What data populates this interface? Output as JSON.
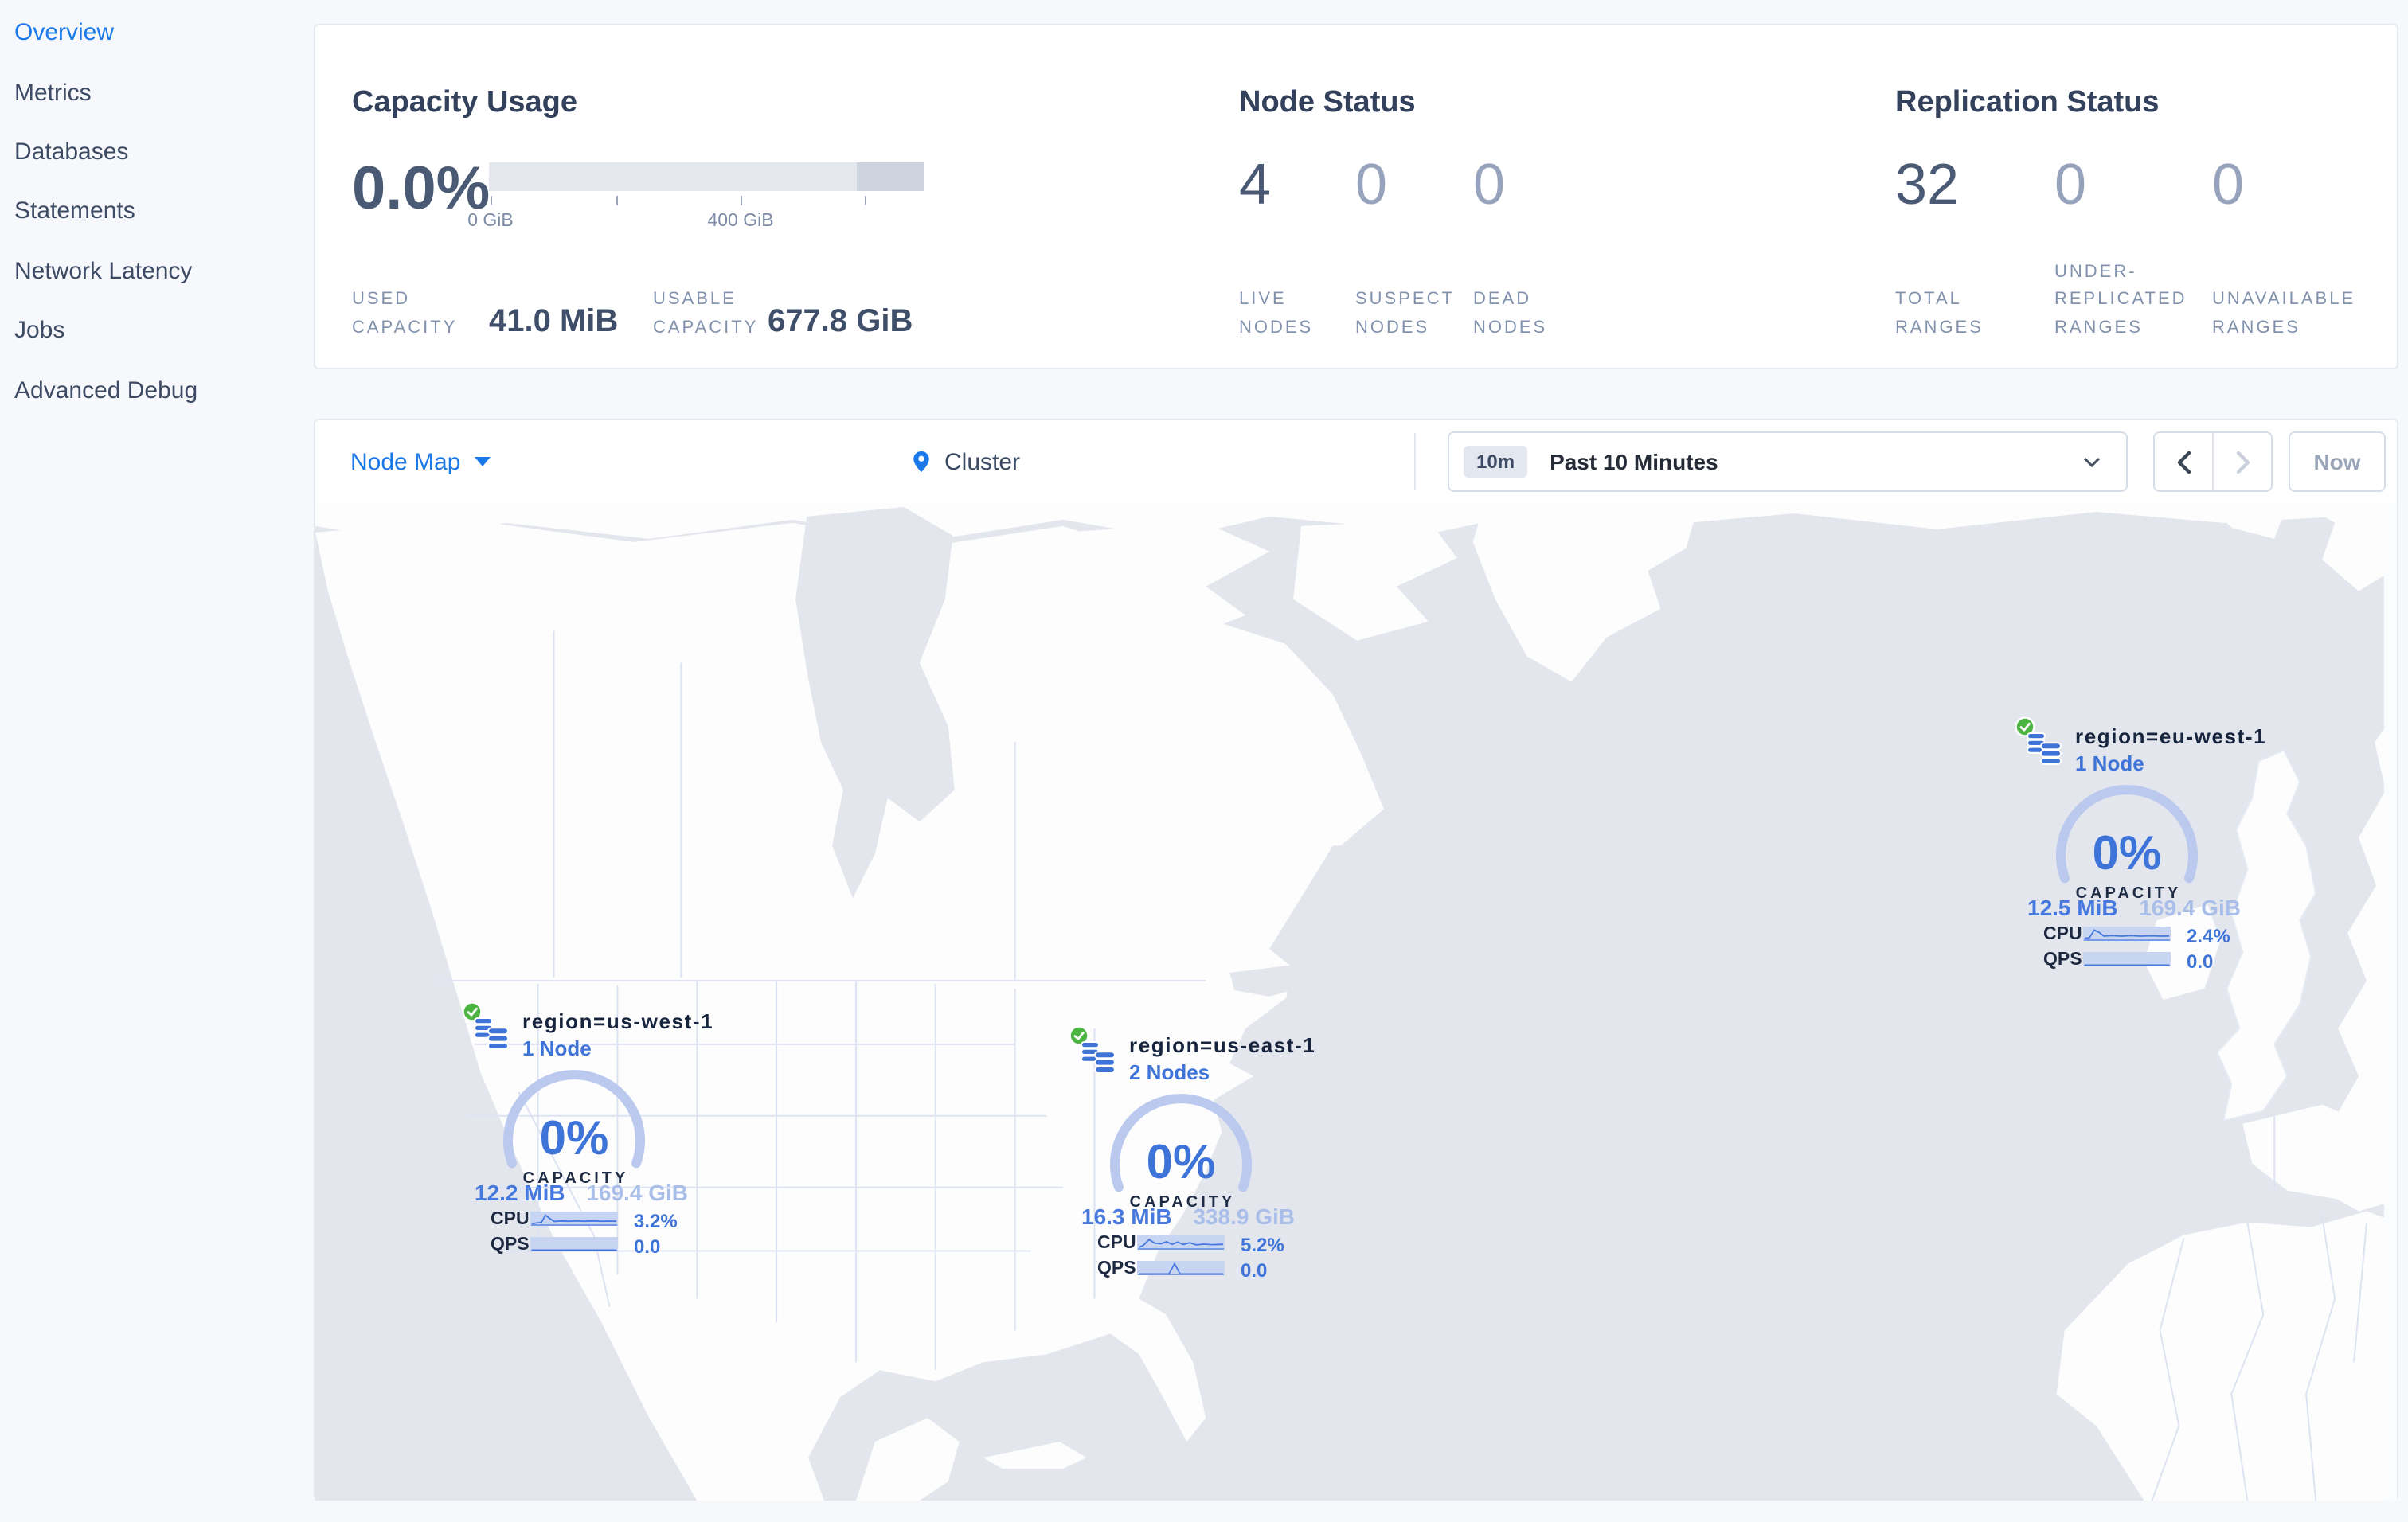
{
  "sidebar": {
    "items": [
      {
        "label": "Overview",
        "active": true
      },
      {
        "label": "Metrics",
        "active": false
      },
      {
        "label": "Databases",
        "active": false
      },
      {
        "label": "Statements",
        "active": false
      },
      {
        "label": "Network Latency",
        "active": false
      },
      {
        "label": "Jobs",
        "active": false
      },
      {
        "label": "Advanced Debug",
        "active": false
      }
    ]
  },
  "cards": {
    "capacity": {
      "title": "Capacity Usage",
      "percent": "0.0%",
      "ticks": [
        "0 GiB",
        "400 GiB"
      ],
      "used": {
        "label": "USED CAPACITY",
        "value": "41.0 MiB"
      },
      "usable": {
        "label": "USABLE CAPACITY",
        "value": "677.8 GiB"
      }
    },
    "node_status": {
      "title": "Node Status",
      "stats": [
        {
          "value": "4",
          "label": "LIVE NODES"
        },
        {
          "value": "0",
          "label": "SUSPECT NODES"
        },
        {
          "value": "0",
          "label": "DEAD NODES"
        }
      ]
    },
    "replication": {
      "title": "Replication Status",
      "stats": [
        {
          "value": "32",
          "label": "TOTAL RANGES"
        },
        {
          "value": "0",
          "label": "UNDER-REPLICATED RANGES"
        },
        {
          "value": "0",
          "label": "UNAVAILABLE RANGES"
        }
      ]
    }
  },
  "toolbar": {
    "view_selector": "Node Map",
    "scope_label": "Cluster",
    "time_badge": "10m",
    "time_range": "Past 10 Minutes",
    "now_button": "Now"
  },
  "map": {
    "regions": [
      {
        "name": "region=us-west-1",
        "nodes": "1 Node",
        "capacity_percent": "0%",
        "capacity_label": "CAPACITY",
        "used": "12.2 MiB",
        "total": "169.4 GiB",
        "cpu_label": "CPU",
        "cpu_value": "3.2%",
        "qps_label": "QPS",
        "qps_value": "0.0",
        "cpu_spark": [
          [
            1,
            7.6
          ],
          [
            4,
            7.2
          ],
          [
            7,
            6.8
          ],
          [
            9.5,
            2.3
          ],
          [
            12,
            4.2
          ],
          [
            15,
            6.2
          ],
          [
            19,
            5.9
          ],
          [
            24,
            6.1
          ],
          [
            29,
            5.9
          ],
          [
            34,
            6.1
          ],
          [
            39,
            5.9
          ],
          [
            45,
            6.1
          ],
          [
            50,
            6.0
          ],
          [
            54,
            6.1
          ]
        ],
        "qps_spark": [
          [
            1,
            8.2
          ],
          [
            54,
            8.2
          ]
        ]
      },
      {
        "name": "region=us-east-1",
        "nodes": "2 Nodes",
        "capacity_percent": "0%",
        "capacity_label": "CAPACITY",
        "used": "16.3 MiB",
        "total": "338.9 GiB",
        "cpu_label": "CPU",
        "cpu_value": "5.2%",
        "qps_label": "QPS",
        "qps_value": "0.0",
        "cpu_spark": [
          [
            1,
            7.6
          ],
          [
            4,
            6.2
          ],
          [
            7.5,
            2.6
          ],
          [
            11,
            4.8
          ],
          [
            15,
            5.2
          ],
          [
            18.5,
            4.0
          ],
          [
            22,
            5.6
          ],
          [
            25.5,
            4.2
          ],
          [
            29,
            5.7
          ],
          [
            33,
            4.6
          ],
          [
            37,
            5.9
          ],
          [
            42,
            5.5
          ],
          [
            47,
            5.8
          ],
          [
            54,
            5.6
          ]
        ],
        "qps_spark": [
          [
            1,
            8.2
          ],
          [
            20,
            8.2
          ],
          [
            23.5,
            1.8
          ],
          [
            27,
            8.2
          ],
          [
            54,
            8.2
          ]
        ]
      },
      {
        "name": "region=eu-west-1",
        "nodes": "1 Node",
        "capacity_percent": "0%",
        "capacity_label": "CAPACITY",
        "used": "12.5 MiB",
        "total": "169.4 GiB",
        "cpu_label": "CPU",
        "cpu_value": "2.4%",
        "qps_label": "QPS",
        "qps_value": "0.0",
        "cpu_spark": [
          [
            1,
            7.4
          ],
          [
            4,
            7.0
          ],
          [
            7,
            2.2
          ],
          [
            10,
            3.6
          ],
          [
            13,
            6.0
          ],
          [
            18,
            5.7
          ],
          [
            24,
            6.0
          ],
          [
            30,
            5.7
          ],
          [
            36,
            6.0
          ],
          [
            43,
            5.8
          ],
          [
            49,
            6.0
          ],
          [
            54,
            5.9
          ]
        ],
        "qps_spark": [
          [
            1,
            8.2
          ],
          [
            54,
            8.2
          ]
        ]
      }
    ]
  },
  "colors": {
    "accent_blue": "#1a79e8",
    "marker_blue": "#3e73d8",
    "pale_blue": "#a9bfe9",
    "gauge_arc": "#bac9ed",
    "status_green": "#4cb440",
    "ocean_gray": "#e3e6ed",
    "land_white": "#fdfdfe",
    "dark_text": "#33415c",
    "muted_number": "#97a3bd",
    "label_gray": "#8292ad"
  }
}
